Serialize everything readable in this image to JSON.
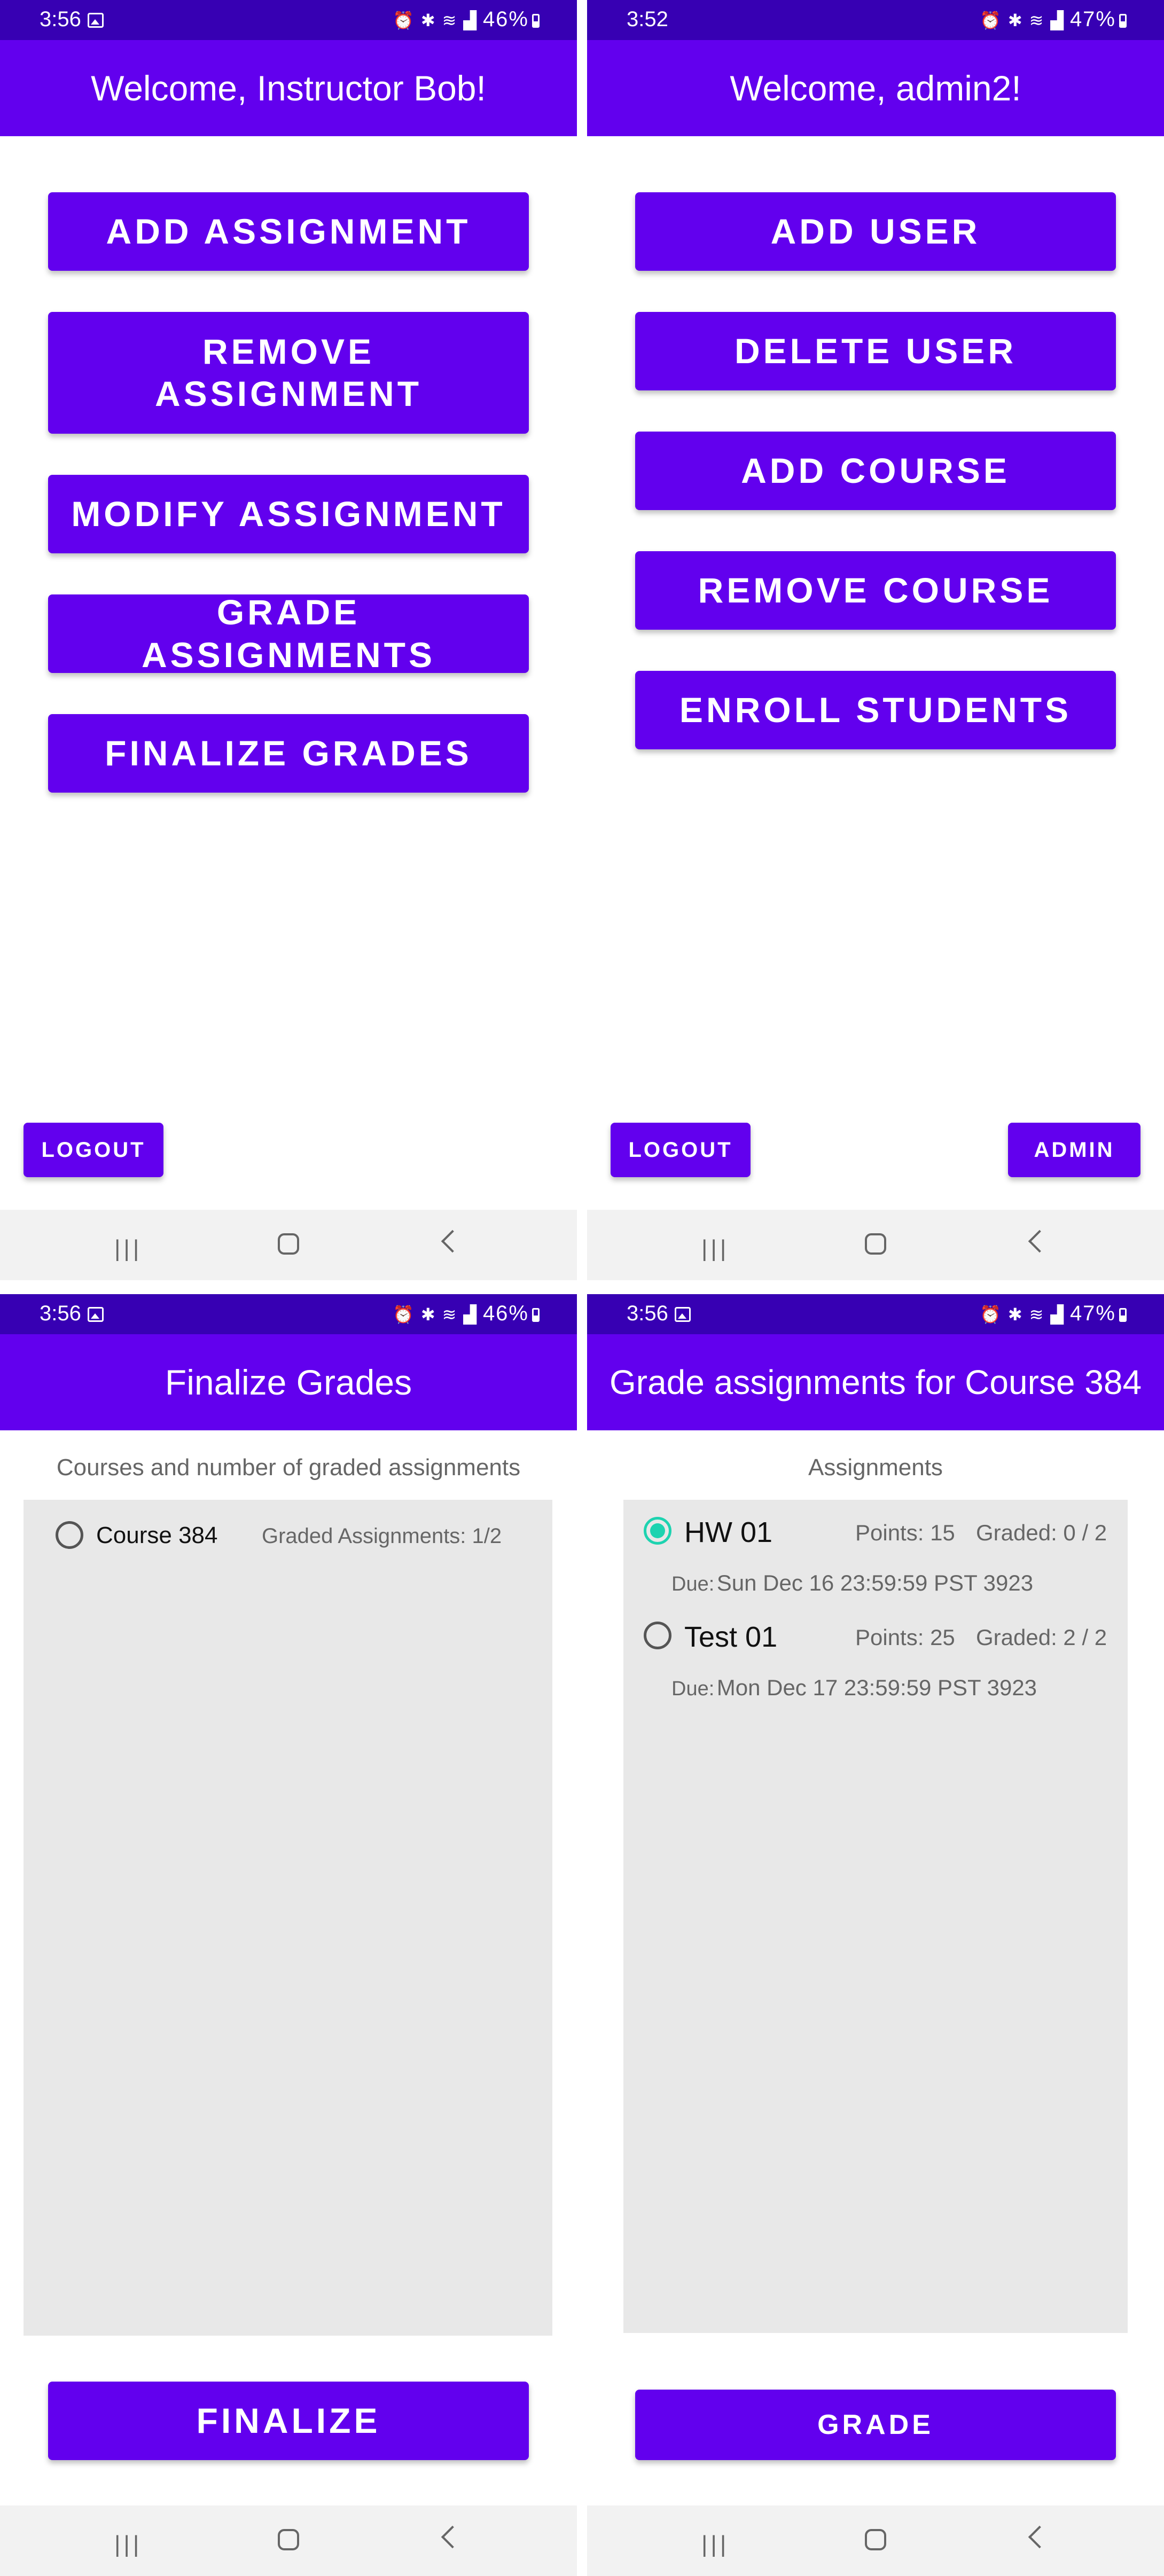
{
  "status_bars": [
    {
      "time": "3:56",
      "battery": "46%"
    },
    {
      "time": "3:52",
      "battery": "47%"
    },
    {
      "time": "3:56",
      "battery": "46%"
    },
    {
      "time": "3:56",
      "battery": "47%"
    }
  ],
  "instructor": {
    "title": "Welcome, Instructor Bob!",
    "buttons": [
      "ADD ASSIGNMENT",
      "REMOVE ASSIGNMENT",
      "MODIFY ASSIGNMENT",
      "GRADE ASSIGNMENTS",
      "FINALIZE GRADES"
    ],
    "logout": "LOGOUT"
  },
  "admin": {
    "title": "Welcome, admin2!",
    "buttons": [
      "ADD USER",
      "DELETE USER",
      "ADD COURSE",
      "REMOVE COURSE",
      "ENROLL STUDENTS"
    ],
    "logout": "LOGOUT",
    "admin": "ADMIN"
  },
  "finalize": {
    "title": "Finalize Grades",
    "subtitle": "Courses and number of graded assignments",
    "courses": [
      {
        "name": "Course 384",
        "graded_label": "Graded Assignments:",
        "graded": "1/2",
        "selected": false
      }
    ],
    "action": "FINALIZE"
  },
  "grade": {
    "title": "Grade assignments for Course 384",
    "subtitle": "Assignments",
    "assignments": [
      {
        "name": "HW 01",
        "points": "Points: 15",
        "graded": "Graded: 0 / 2",
        "due_label": "Due:",
        "due": "Sun Dec 16 23:59:59 PST 3923",
        "selected": true
      },
      {
        "name": "Test 01",
        "points": "Points: 25",
        "graded": "Graded: 2 / 2",
        "due_label": "Due:",
        "due": "Mon Dec 17 23:59:59 PST 3923",
        "selected": false
      }
    ],
    "action": "GRADE"
  },
  "colors": {
    "primary": "#6200ee",
    "status_bar": "#3700b3",
    "radio_selected": "#1dd3b0",
    "panel": "#e8e8e8"
  },
  "icons": [
    "gallery-icon",
    "alarm-icon",
    "bluetooth-icon",
    "wifi-icon",
    "signal-icon",
    "battery-icon",
    "recents-icon",
    "home-icon",
    "back-icon"
  ]
}
